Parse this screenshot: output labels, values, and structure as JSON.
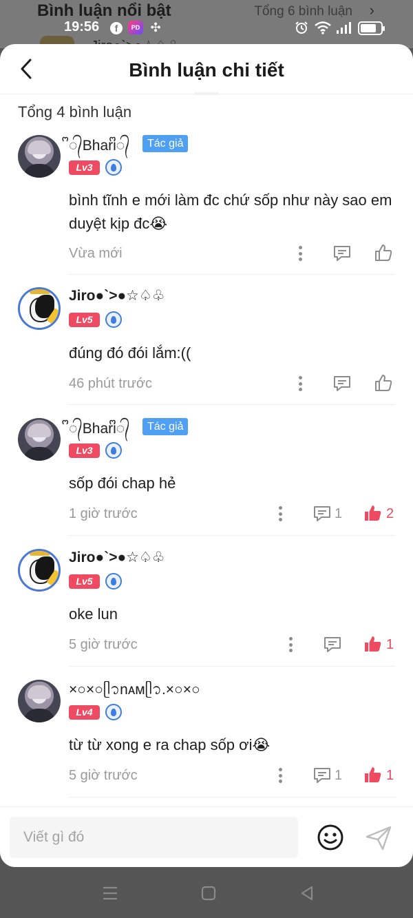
{
  "background_page": {
    "title": "Bình luận nổi bật",
    "count": "Tổng 6 bình luận",
    "partial_name": "Jiro●`>●☆♤♧"
  },
  "status_bar": {
    "time": "19:56",
    "app_badge": "PD"
  },
  "sheet": {
    "title": "Bình luận chi tiết",
    "total": "Tổng 4 bình luận"
  },
  "colors": {
    "level_badge": "#ee4b62",
    "author_badge": "#4f9ff3",
    "like_active": "#ee4b62",
    "muted_text": "#9a9a9a"
  },
  "comments": [
    {
      "username": "ᩚ᭄Bhariᩚ᭄",
      "author_badge": "Tác giả",
      "level": "Lv3",
      "text": "bình tĩnh e mới làm đc chứ sốp như này sao em duyệt kịp đc😭",
      "time": "Vừa mới",
      "reply_count": "",
      "like_count": "",
      "liked": false
    },
    {
      "username": "Jiro●`>●☆♤♧",
      "author_badge": "",
      "level": "Lv5",
      "text": "đúng đó đói lắm:((",
      "time": "46 phút trước",
      "reply_count": "",
      "like_count": "",
      "liked": false
    },
    {
      "username": "ᩚ᭄Bhariᩚ᭄",
      "author_badge": "Tác giả",
      "level": "Lv3",
      "text": "sốp đói chap hẻ",
      "time": "1 giờ trước",
      "reply_count": "1",
      "like_count": "2",
      "liked": true
    },
    {
      "username": "Jiro●`>●☆♤♧",
      "author_badge": "",
      "level": "Lv5",
      "text": "oke lun",
      "time": "5 giờ trước",
      "reply_count": "",
      "like_count": "1",
      "liked": true
    },
    {
      "username": "×○×○ᥫ᭡nᴀмᥫ᭡.×○×○",
      "author_badge": "",
      "level": "Lv4",
      "text": "từ từ xong e ra chap sốp ơi😭",
      "time": "5 giờ trước",
      "reply_count": "1",
      "like_count": "1",
      "liked": true
    }
  ],
  "input": {
    "placeholder": "Viết gì đó"
  }
}
